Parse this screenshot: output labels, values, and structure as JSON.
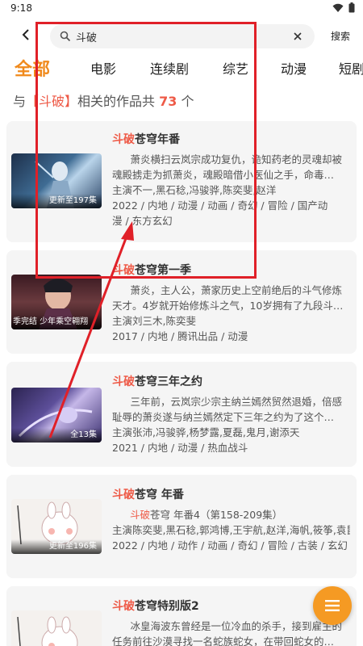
{
  "status": {
    "time": "9:18"
  },
  "search": {
    "query": "斗破",
    "button_label": "搜索"
  },
  "tabs": [
    {
      "label": "全部",
      "active": true
    },
    {
      "label": "电影"
    },
    {
      "label": "连续剧"
    },
    {
      "label": "综艺"
    },
    {
      "label": "动漫"
    },
    {
      "label": "短剧"
    }
  ],
  "result_summary": {
    "prefix": "与",
    "keyword": "【斗破】",
    "middle": "相关的作品共",
    "count": "73",
    "suffix": "个"
  },
  "results": [
    {
      "title_highlight": "斗破",
      "title_rest": "苍穹年番",
      "badge": "更新至197集",
      "desc": "萧炎横扫云岚宗成功复仇，诡知药老的灵魂却被魂殿掳走为抓萧炎，魂殿暗借小医仙之手，命毒…",
      "cast": "主演不一,黑石稔,冯骏骅,陈奕斐,赵洋",
      "tags_line1": "2022 / 内地 / 动漫 / 动画 / 奇幻 / 冒险 / 国产动",
      "tags_line2": "漫 / 东方玄幻"
    },
    {
      "title_highlight": "斗破",
      "title_rest": "苍穹第一季",
      "badge": "季完结 少年乘空翱翔",
      "desc": "萧炎，主人公，萧家历史上空前绝后的斗气修炼天才。4岁就开始修炼斗之气，10岁拥有了九段斗…",
      "cast": "主演刘三木,陈奕斐",
      "tags_line1": "2017 / 内地 / 腾讯出品 / 动漫"
    },
    {
      "title_highlight": "斗破",
      "title_rest": "苍穹三年之约",
      "badge": "全13集",
      "desc": "三年前，云岚宗少宗主纳兰嫣然贸然退婚，倍感耻辱的萧炎遂与纳兰嫣然定下三年之约为了这个…",
      "cast": "主演张沛,冯骏骅,杨梦露,夏磊,鬼月,谢添天",
      "tags_line1": "2021 / 内地 / 动漫 / 热血战斗"
    },
    {
      "title_highlight": "斗破",
      "title_rest": "苍穹 年番",
      "badge": "更新至196集",
      "desc_hl": "斗破",
      "desc_rest": "苍穹 年番4（第158-209集）",
      "cast": "主演陈奕斐,黑石稔,郭鸿博,王宇航,赵洋,海帆,筱筝,袁昆",
      "tags_line1": "2022 / 内地 / 动作 / 动画 / 奇幻 / 冒险 / 古装 / 玄幻"
    },
    {
      "title_highlight": "斗破",
      "title_rest": "苍穹特别版2",
      "desc": "冰皇海波东曾经是一位冷血的杀手，接到雇主的任务前往沙漠寻找一名蛇族蛇女，在带回蛇女的…"
    }
  ],
  "colors": {
    "accent": "#f08a1c",
    "highlight": "#ee5a47",
    "fab": "#f59a23",
    "annotation": "#e02028"
  },
  "icons": [
    "back-arrow-icon",
    "search-icon",
    "clear-icon",
    "menu-icon",
    "wifi-icon",
    "battery-icon"
  ]
}
